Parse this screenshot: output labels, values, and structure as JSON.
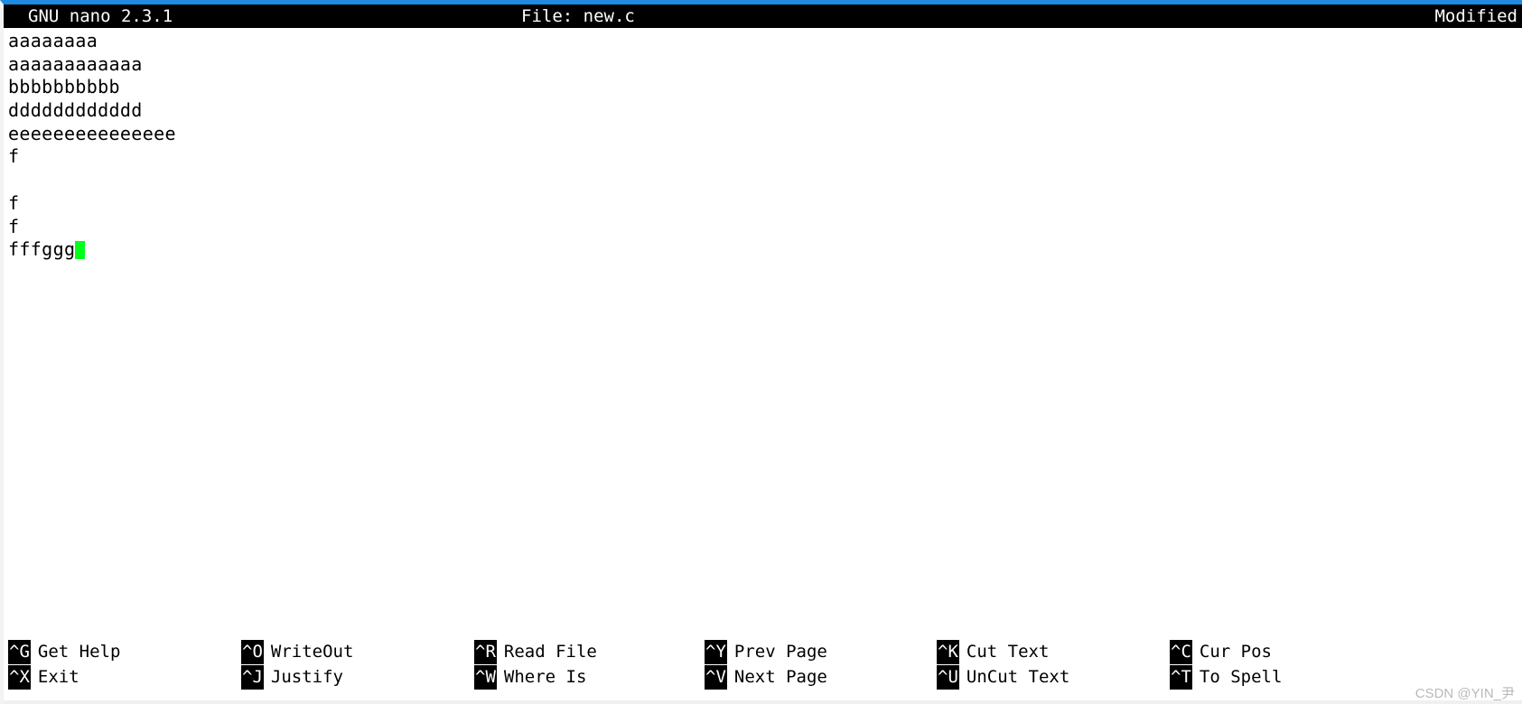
{
  "window": {
    "accent_color": "#1e8ae0",
    "background": "#ffffff",
    "foreground": "#000000",
    "cursor_color": "#00ff19"
  },
  "titlebar": {
    "version": "GNU nano 2.3.1",
    "file_label": "File: new.c",
    "modified": "Modified"
  },
  "editor": {
    "lines": [
      "aaaaaaaa",
      "aaaaaaaaaaaa",
      "bbbbbbbbbb",
      "dddddddddddd",
      "eeeeeeeeeeeeeee",
      "f",
      "",
      "f",
      "f",
      "fffggg"
    ],
    "cursor": {
      "line": 9,
      "column": 6
    }
  },
  "helpbar": {
    "rows": [
      [
        {
          "key": "^G",
          "label": "Get Help"
        },
        {
          "key": "^O",
          "label": "WriteOut"
        },
        {
          "key": "^R",
          "label": "Read File"
        },
        {
          "key": "^Y",
          "label": "Prev Page"
        },
        {
          "key": "^K",
          "label": "Cut Text"
        },
        {
          "key": "^C",
          "label": "Cur Pos"
        }
      ],
      [
        {
          "key": "^X",
          "label": "Exit"
        },
        {
          "key": "^J",
          "label": "Justify"
        },
        {
          "key": "^W",
          "label": "Where Is"
        },
        {
          "key": "^V",
          "label": "Next Page"
        },
        {
          "key": "^U",
          "label": "UnCut Text"
        },
        {
          "key": "^T",
          "label": "To Spell"
        }
      ]
    ]
  },
  "watermark": {
    "text": "CSDN @YIN_尹"
  }
}
